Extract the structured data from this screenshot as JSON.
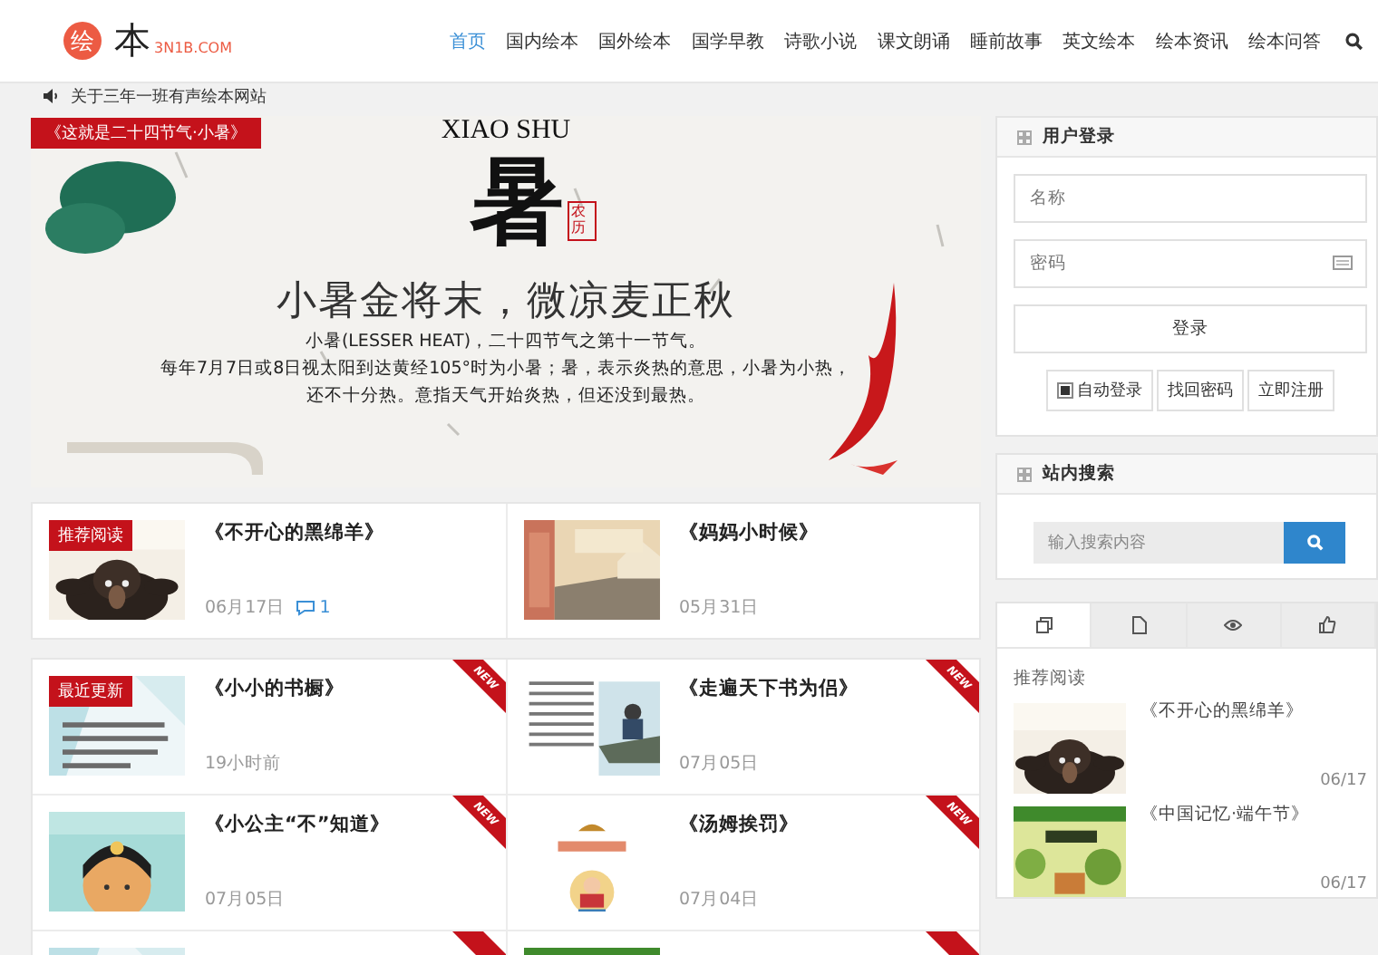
{
  "header": {
    "logo": {
      "mark": "绘",
      "word": "本",
      "domain": "3N1B.COM"
    },
    "nav": [
      {
        "label": "首页",
        "selected": true
      },
      {
        "label": "国内绘本",
        "selected": false
      },
      {
        "label": "国外绘本",
        "selected": false
      },
      {
        "label": "国学早教",
        "selected": false
      },
      {
        "label": "诗歌小说",
        "selected": false
      },
      {
        "label": "课文朗诵",
        "selected": false
      },
      {
        "label": "睡前故事",
        "selected": false
      },
      {
        "label": "英文绘本",
        "selected": false
      },
      {
        "label": "绘本资讯",
        "selected": false
      },
      {
        "label": "绘本问答",
        "selected": false
      }
    ]
  },
  "notice": "关于三年一班有声绘本网站",
  "banner": {
    "caption": "《这就是二十四节气·小暑》",
    "latin": "XIAO SHU",
    "glyph": "暑",
    "seal": "农历",
    "headline": "小暑金将末，微凉麦正秋",
    "lines": [
      "小暑(LESSER HEAT)，二十四节气之第十一节气。",
      "每年7月7日或8日视太阳到达黄经105°时为小暑；暑，表示炎热的意思，小暑为小热，",
      "还不十分热。意指天气开始炎热，但还没到最热。"
    ]
  },
  "featured": [
    {
      "title": "《不开心的黑绵羊》",
      "date": "06月17日",
      "comments": "1",
      "badge": "推荐阅读"
    },
    {
      "title": "《妈妈小时候》",
      "date": "05月31日"
    }
  ],
  "latest": [
    {
      "title": "《小小的书橱》",
      "date": "19小时前",
      "badge": "最近更新",
      "ribbon": "NEW"
    },
    {
      "title": "《走遍天下书为侣》",
      "date": "07月05日",
      "ribbon": "NEW"
    },
    {
      "title": "《小公主“不”知道》",
      "date": "07月05日",
      "ribbon": "NEW"
    },
    {
      "title": "《汤姆挨罚》",
      "date": "07月04日",
      "ribbon": "NEW"
    },
    {
      "new": true
    },
    {
      "new": true
    }
  ],
  "login": {
    "title": "用户登录",
    "name_placeholder": "名称",
    "password_placeholder": "密码",
    "submit": "登录",
    "remember": {
      "label": "自动登录",
      "checked": true
    },
    "links": [
      "找回密码",
      "立即注册"
    ]
  },
  "search": {
    "title": "站内搜索",
    "placeholder": "输入搜索内容"
  },
  "tabs": [
    {
      "kind": "copy",
      "selected": true
    },
    {
      "kind": "file",
      "selected": false
    },
    {
      "kind": "eye",
      "selected": false
    },
    {
      "kind": "thumb",
      "selected": false
    }
  ],
  "recommend": {
    "label": "推荐阅读",
    "items": [
      {
        "title": "《不开心的黑绵羊》",
        "date": "06/17"
      },
      {
        "title": "《中国记忆·端午节》",
        "date": "06/17"
      }
    ]
  }
}
